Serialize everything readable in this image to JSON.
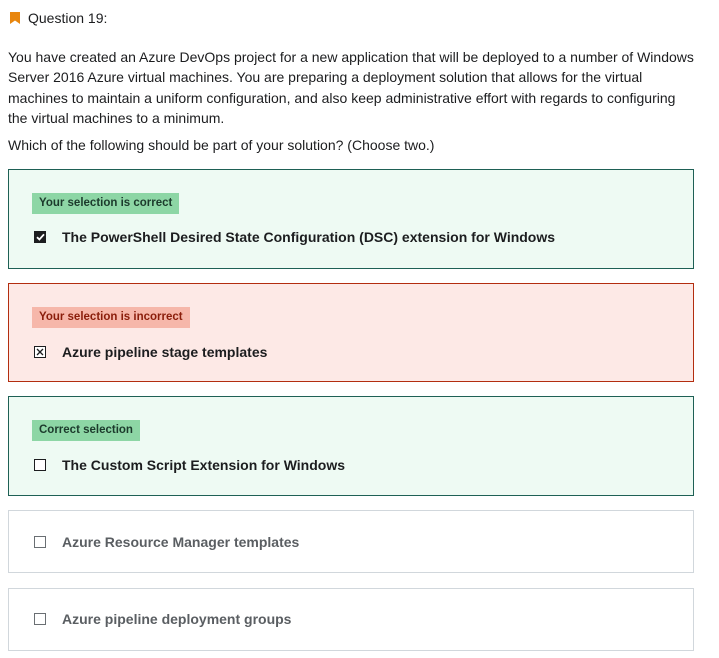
{
  "question": {
    "number_label": "Question 19:",
    "bookmark_color": "#e8860e",
    "text": "You have created an Azure DevOps project for a new application that will be deployed to a number of Windows Server 2016 Azure virtual machines. You are preparing a deployment solution that allows for the virtual machines to maintain a uniform configuration, and also keep administrative effort with regards to configuring the virtual machines to a minimum.",
    "prompt": "Which of the following should be part of your solution? (Choose two.)"
  },
  "options": [
    {
      "badge": "Your selection is correct",
      "label": "The PowerShell Desired State Configuration (DSC) extension for Windows",
      "state": "selected-correct",
      "checked": true
    },
    {
      "badge": "Your selection is incorrect",
      "label": "Azure pipeline stage templates",
      "state": "selected-incorrect",
      "checked": true
    },
    {
      "badge": "Correct selection",
      "label": "The Custom Script Extension for Windows",
      "state": "missed-correct",
      "checked": false
    },
    {
      "label": "Azure Resource Manager templates",
      "state": "unselected",
      "checked": false
    },
    {
      "label": "Azure pipeline deployment groups",
      "state": "unselected",
      "checked": false
    }
  ],
  "colors": {
    "correct_bg": "#eefaf3",
    "correct_border": "#1e6055",
    "incorrect_bg": "#fde9e6",
    "incorrect_border": "#b32d0f"
  }
}
